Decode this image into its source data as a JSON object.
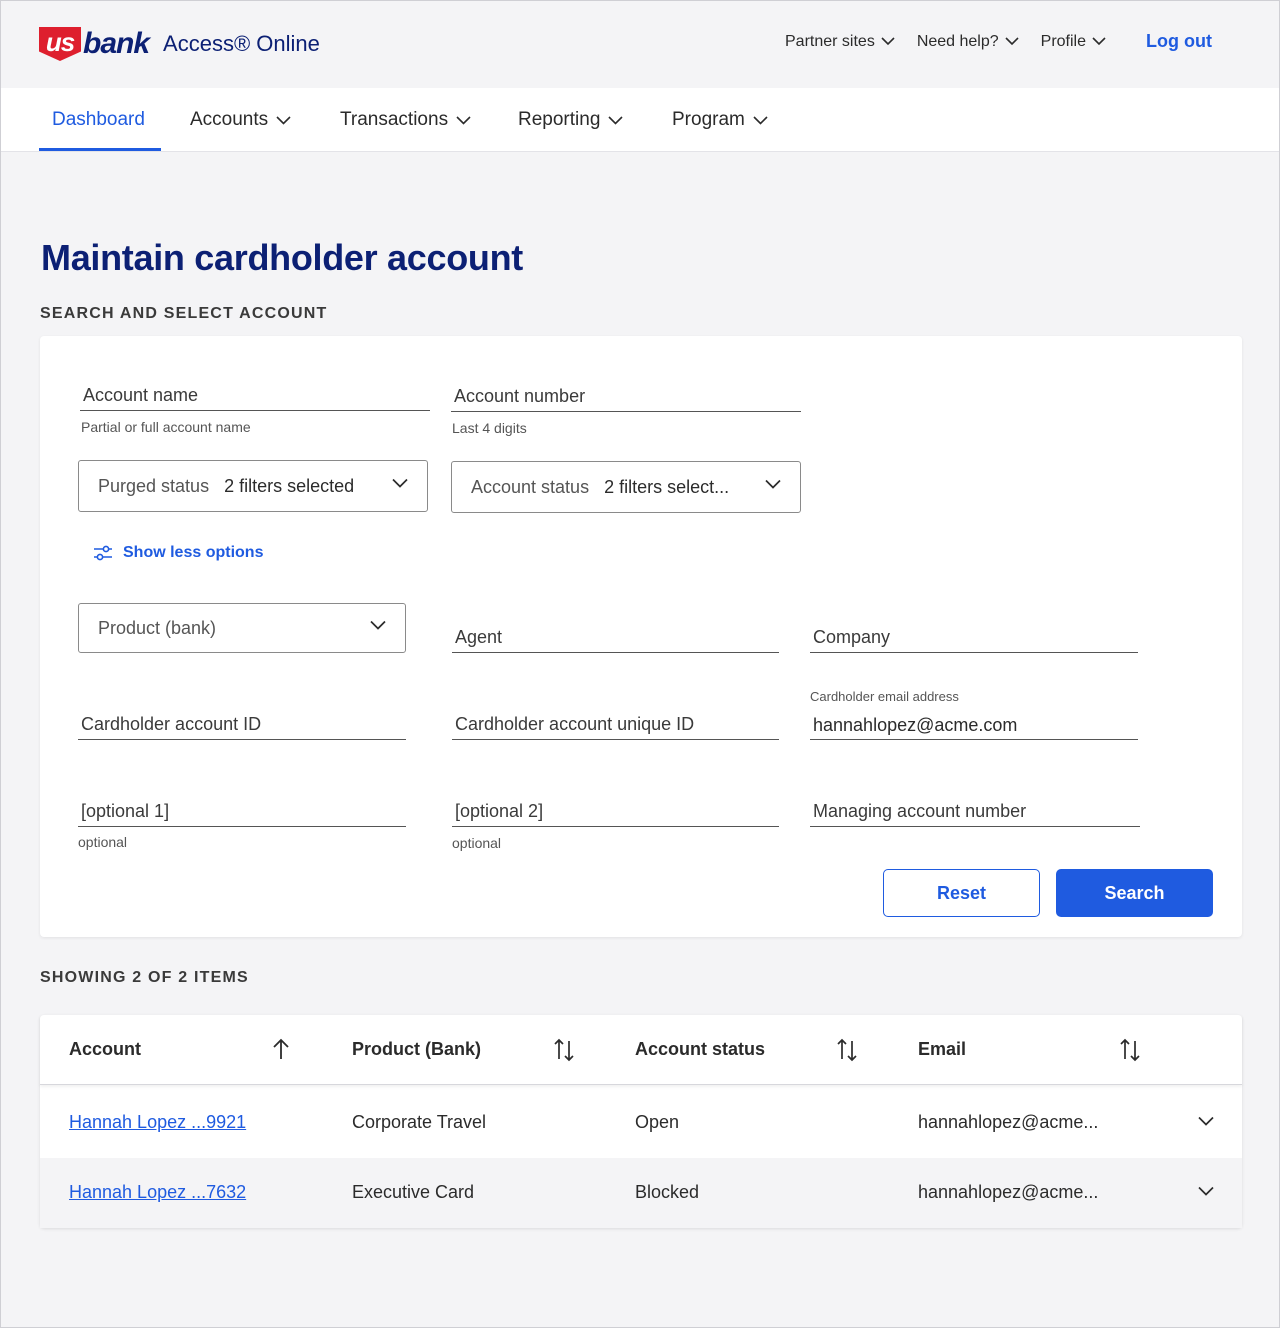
{
  "brand": {
    "logo_us": "us",
    "logo_bank": "bank",
    "product_name": "Access® Online"
  },
  "top_links": {
    "partner_sites": "Partner sites",
    "need_help": "Need help?",
    "profile": "Profile",
    "logout": "Log out"
  },
  "nav": {
    "dashboard": "Dashboard",
    "accounts": "Accounts",
    "transactions": "Transactions",
    "reporting": "Reporting",
    "program": "Program"
  },
  "page": {
    "title": "Maintain cardholder account",
    "search_section": "SEARCH AND SELECT ACCOUNT",
    "results_section": "SHOWING 2 OF 2 ITEMS"
  },
  "search": {
    "account_name": {
      "label": "Account name",
      "helper": "Partial or full account name"
    },
    "account_number": {
      "label": "Account number",
      "helper": "Last 4 digits"
    },
    "purged_status": {
      "label": "Purged status",
      "value": "2 filters selected"
    },
    "account_status": {
      "label": "Account status",
      "value": "2 filters select..."
    },
    "show_less": "Show less options",
    "product_bank": {
      "label": "Product (bank)"
    },
    "agent": {
      "label": "Agent"
    },
    "company": {
      "label": "Company"
    },
    "cardholder_account_id": {
      "label": "Cardholder account ID"
    },
    "cardholder_unique_id": {
      "label": "Cardholder account unique ID"
    },
    "cardholder_email": {
      "label": "Cardholder email address",
      "value": "hannahlopez@acme.com"
    },
    "optional1": {
      "label": "[optional 1]",
      "helper": "optional"
    },
    "optional2": {
      "label": "[optional 2]",
      "helper": "optional"
    },
    "managing_account": {
      "label": "Managing account number"
    },
    "reset": "Reset",
    "search": "Search"
  },
  "table": {
    "headers": {
      "account": "Account",
      "product": "Product (Bank)",
      "status": "Account status",
      "email": "Email"
    },
    "rows": [
      {
        "account": "Hannah Lopez ...9921",
        "product": "Corporate Travel",
        "status": "Open",
        "email": "hannahlopez@acme..."
      },
      {
        "account": "Hannah Lopez ...7632",
        "product": "Executive Card",
        "status": "Blocked",
        "email": "hannahlopez@acme..."
      }
    ]
  },
  "colors": {
    "brand_red": "#de1f2e",
    "brand_navy": "#0c2074",
    "accent_blue": "#1f5be0",
    "page_bg": "#f4f4f6"
  }
}
